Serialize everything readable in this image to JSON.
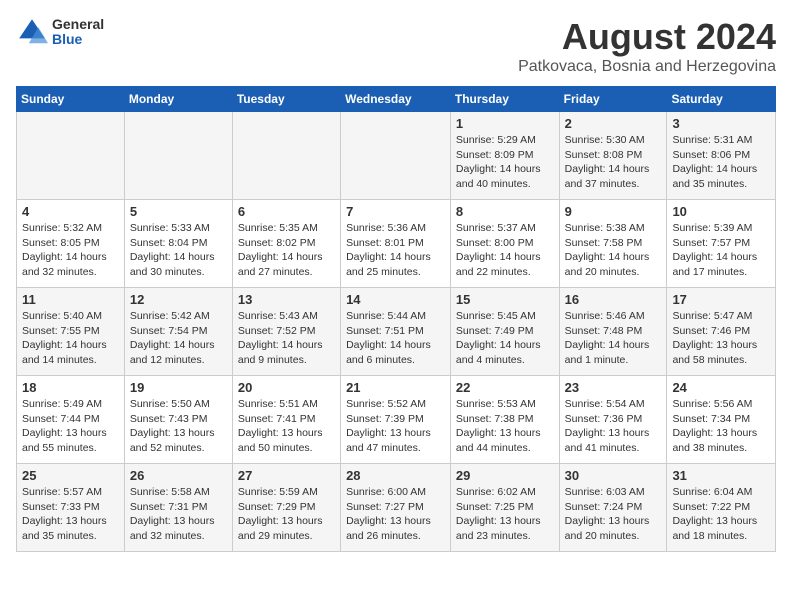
{
  "header": {
    "logo": {
      "general": "General",
      "blue": "Blue"
    },
    "title": "August 2024",
    "location": "Patkovaca, Bosnia and Herzegovina"
  },
  "calendar": {
    "days": [
      "Sunday",
      "Monday",
      "Tuesday",
      "Wednesday",
      "Thursday",
      "Friday",
      "Saturday"
    ],
    "weeks": [
      {
        "cells": [
          {
            "day": "",
            "info": ""
          },
          {
            "day": "",
            "info": ""
          },
          {
            "day": "",
            "info": ""
          },
          {
            "day": "",
            "info": ""
          },
          {
            "day": "1",
            "info": "Sunrise: 5:29 AM\nSunset: 8:09 PM\nDaylight: 14 hours\nand 40 minutes."
          },
          {
            "day": "2",
            "info": "Sunrise: 5:30 AM\nSunset: 8:08 PM\nDaylight: 14 hours\nand 37 minutes."
          },
          {
            "day": "3",
            "info": "Sunrise: 5:31 AM\nSunset: 8:06 PM\nDaylight: 14 hours\nand 35 minutes."
          }
        ]
      },
      {
        "cells": [
          {
            "day": "4",
            "info": "Sunrise: 5:32 AM\nSunset: 8:05 PM\nDaylight: 14 hours\nand 32 minutes."
          },
          {
            "day": "5",
            "info": "Sunrise: 5:33 AM\nSunset: 8:04 PM\nDaylight: 14 hours\nand 30 minutes."
          },
          {
            "day": "6",
            "info": "Sunrise: 5:35 AM\nSunset: 8:02 PM\nDaylight: 14 hours\nand 27 minutes."
          },
          {
            "day": "7",
            "info": "Sunrise: 5:36 AM\nSunset: 8:01 PM\nDaylight: 14 hours\nand 25 minutes."
          },
          {
            "day": "8",
            "info": "Sunrise: 5:37 AM\nSunset: 8:00 PM\nDaylight: 14 hours\nand 22 minutes."
          },
          {
            "day": "9",
            "info": "Sunrise: 5:38 AM\nSunset: 7:58 PM\nDaylight: 14 hours\nand 20 minutes."
          },
          {
            "day": "10",
            "info": "Sunrise: 5:39 AM\nSunset: 7:57 PM\nDaylight: 14 hours\nand 17 minutes."
          }
        ]
      },
      {
        "cells": [
          {
            "day": "11",
            "info": "Sunrise: 5:40 AM\nSunset: 7:55 PM\nDaylight: 14 hours\nand 14 minutes."
          },
          {
            "day": "12",
            "info": "Sunrise: 5:42 AM\nSunset: 7:54 PM\nDaylight: 14 hours\nand 12 minutes."
          },
          {
            "day": "13",
            "info": "Sunrise: 5:43 AM\nSunset: 7:52 PM\nDaylight: 14 hours\nand 9 minutes."
          },
          {
            "day": "14",
            "info": "Sunrise: 5:44 AM\nSunset: 7:51 PM\nDaylight: 14 hours\nand 6 minutes."
          },
          {
            "day": "15",
            "info": "Sunrise: 5:45 AM\nSunset: 7:49 PM\nDaylight: 14 hours\nand 4 minutes."
          },
          {
            "day": "16",
            "info": "Sunrise: 5:46 AM\nSunset: 7:48 PM\nDaylight: 14 hours\nand 1 minute."
          },
          {
            "day": "17",
            "info": "Sunrise: 5:47 AM\nSunset: 7:46 PM\nDaylight: 13 hours\nand 58 minutes."
          }
        ]
      },
      {
        "cells": [
          {
            "day": "18",
            "info": "Sunrise: 5:49 AM\nSunset: 7:44 PM\nDaylight: 13 hours\nand 55 minutes."
          },
          {
            "day": "19",
            "info": "Sunrise: 5:50 AM\nSunset: 7:43 PM\nDaylight: 13 hours\nand 52 minutes."
          },
          {
            "day": "20",
            "info": "Sunrise: 5:51 AM\nSunset: 7:41 PM\nDaylight: 13 hours\nand 50 minutes."
          },
          {
            "day": "21",
            "info": "Sunrise: 5:52 AM\nSunset: 7:39 PM\nDaylight: 13 hours\nand 47 minutes."
          },
          {
            "day": "22",
            "info": "Sunrise: 5:53 AM\nSunset: 7:38 PM\nDaylight: 13 hours\nand 44 minutes."
          },
          {
            "day": "23",
            "info": "Sunrise: 5:54 AM\nSunset: 7:36 PM\nDaylight: 13 hours\nand 41 minutes."
          },
          {
            "day": "24",
            "info": "Sunrise: 5:56 AM\nSunset: 7:34 PM\nDaylight: 13 hours\nand 38 minutes."
          }
        ]
      },
      {
        "cells": [
          {
            "day": "25",
            "info": "Sunrise: 5:57 AM\nSunset: 7:33 PM\nDaylight: 13 hours\nand 35 minutes."
          },
          {
            "day": "26",
            "info": "Sunrise: 5:58 AM\nSunset: 7:31 PM\nDaylight: 13 hours\nand 32 minutes."
          },
          {
            "day": "27",
            "info": "Sunrise: 5:59 AM\nSunset: 7:29 PM\nDaylight: 13 hours\nand 29 minutes."
          },
          {
            "day": "28",
            "info": "Sunrise: 6:00 AM\nSunset: 7:27 PM\nDaylight: 13 hours\nand 26 minutes."
          },
          {
            "day": "29",
            "info": "Sunrise: 6:02 AM\nSunset: 7:25 PM\nDaylight: 13 hours\nand 23 minutes."
          },
          {
            "day": "30",
            "info": "Sunrise: 6:03 AM\nSunset: 7:24 PM\nDaylight: 13 hours\nand 20 minutes."
          },
          {
            "day": "31",
            "info": "Sunrise: 6:04 AM\nSunset: 7:22 PM\nDaylight: 13 hours\nand 18 minutes."
          }
        ]
      }
    ]
  }
}
